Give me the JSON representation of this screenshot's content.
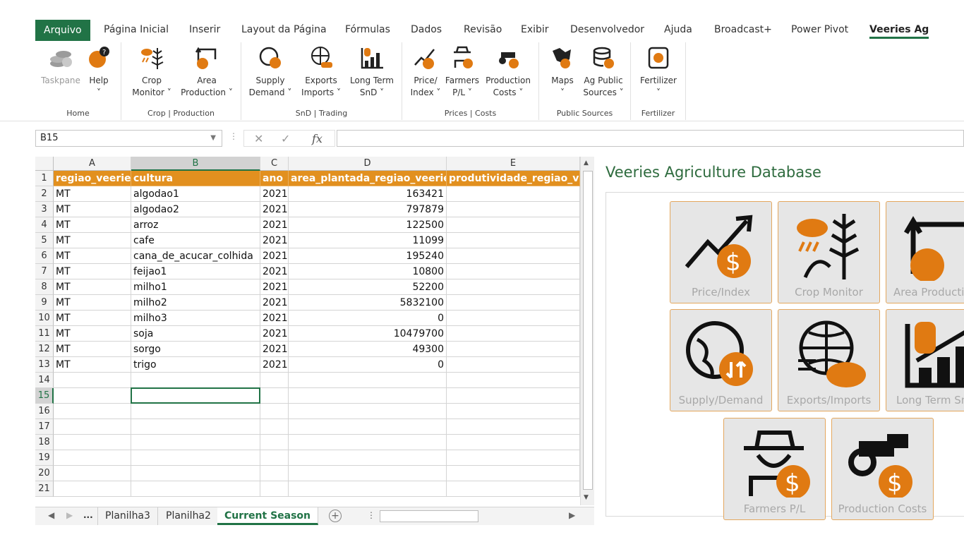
{
  "ribbon_tabs": [
    "Arquivo",
    "Página Inicial",
    "Inserir",
    "Layout da Página",
    "Fórmulas",
    "Dados",
    "Revisão",
    "Exibir",
    "Desenvolvedor",
    "Ajuda",
    "Broadcast+",
    "Power Pivot",
    "Veeries Ag"
  ],
  "ribbon": {
    "home": {
      "label": "Home",
      "taskpane": "Taskpane",
      "help": "Help"
    },
    "crop": {
      "label": "Crop | Production",
      "monitor_1": "Crop",
      "monitor_2": "Monitor ˅",
      "area_1": "Area",
      "area_2": "Production ˅"
    },
    "snd": {
      "label": "SnD | Trading",
      "supply_1": "Supply",
      "supply_2": "Demand ˅",
      "exports_1": "Exports",
      "exports_2": "Imports ˅",
      "lt_1": "Long Term",
      "lt_2": "SnD ˅"
    },
    "prices": {
      "label": "Prices | Costs",
      "price_1": "Price/",
      "price_2": "Index ˅",
      "farmers_1": "Farmers",
      "farmers_2": "P/L ˅",
      "costs_1": "Production",
      "costs_2": "Costs ˅"
    },
    "public": {
      "label": "Public Sources",
      "maps_1": "Maps",
      "maps_2": "˅",
      "ag_1": "Ag Public",
      "ag_2": "Sources ˅"
    },
    "fert": {
      "label": "Fertilizer",
      "fert_1": "Fertilizer",
      "fert_2": "˅"
    }
  },
  "formula_bar": {
    "name_box": "B15",
    "fx": "fx",
    "cancel": "✕",
    "enter": "✓",
    "value": ""
  },
  "columns": [
    "A",
    "B",
    "C",
    "D",
    "E"
  ],
  "rows": [
    "1",
    "2",
    "3",
    "4",
    "5",
    "6",
    "7",
    "8",
    "9",
    "10",
    "11",
    "12",
    "13",
    "14",
    "15",
    "16",
    "17",
    "18",
    "19",
    "20",
    "21"
  ],
  "headers": [
    "regiao_veeries",
    "cultura",
    "ano",
    "area_plantada_regiao_veeries",
    "produtividade_regiao_veeries"
  ],
  "data": [
    [
      "MT",
      "algodao1",
      "2021",
      "163421"
    ],
    [
      "MT",
      "algodao2",
      "2021",
      "797879"
    ],
    [
      "MT",
      "arroz",
      "2021",
      "122500"
    ],
    [
      "MT",
      "cafe",
      "2021",
      "11099"
    ],
    [
      "MT",
      "cana_de_acucar_colhida",
      "2021",
      "195240"
    ],
    [
      "MT",
      "feijao1",
      "2021",
      "10800"
    ],
    [
      "MT",
      "milho1",
      "2021",
      "52200"
    ],
    [
      "MT",
      "milho2",
      "2021",
      "5832100"
    ],
    [
      "MT",
      "milho3",
      "2021",
      "0"
    ],
    [
      "MT",
      "soja",
      "2021",
      "10479700"
    ],
    [
      "MT",
      "sorgo",
      "2021",
      "49300"
    ],
    [
      "MT",
      "trigo",
      "2021",
      "0"
    ]
  ],
  "sheets": {
    "more": "...",
    "tabs": [
      "Planilha3",
      "Planilha2",
      "Current Season"
    ],
    "active": "Current Season",
    "add": "+"
  },
  "taskpane": {
    "title": "Veeries Agriculture Database",
    "tiles": [
      "Price/Index",
      "Crop Monitor",
      "Area Producti",
      "Supply/Demand",
      "Exports/Imports",
      "Long Term Sn",
      "Farmers P/L",
      "Production Costs"
    ]
  },
  "colors": {
    "excel_green": "#217346",
    "header_orange": "#e2901f",
    "icon_orange": "#e07a12"
  }
}
